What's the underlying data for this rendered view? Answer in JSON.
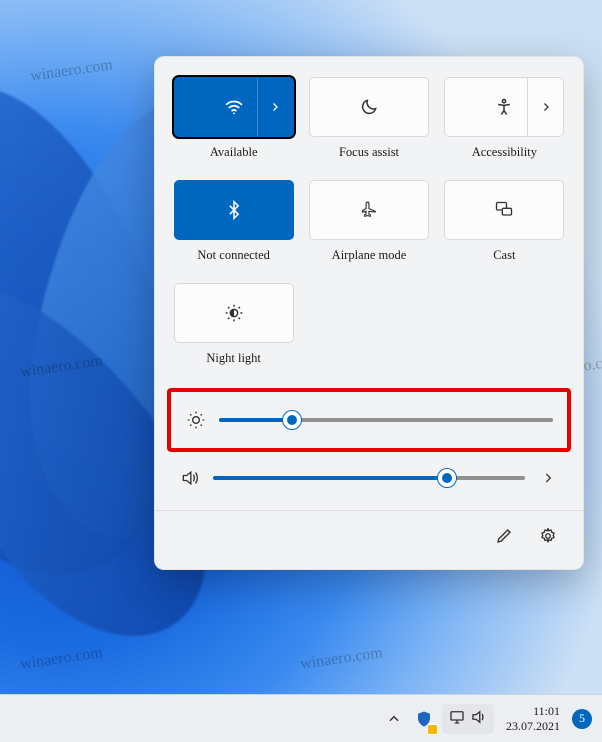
{
  "watermark": "winaero.com",
  "panel": {
    "tiles": [
      {
        "id": "wifi",
        "label": "Available",
        "active": true,
        "split": true,
        "selected": true
      },
      {
        "id": "focus",
        "label": "Focus assist",
        "active": false,
        "split": false
      },
      {
        "id": "accessibility",
        "label": "Accessibility",
        "active": false,
        "split": true
      },
      {
        "id": "bluetooth",
        "label": "Not connected",
        "active": true,
        "split": false
      },
      {
        "id": "airplane",
        "label": "Airplane mode",
        "active": false,
        "split": false
      },
      {
        "id": "cast",
        "label": "Cast",
        "active": false,
        "split": false
      },
      {
        "id": "nightlight",
        "label": "Night light",
        "active": false,
        "split": false
      }
    ],
    "sliders": {
      "brightness": {
        "value": 22,
        "highlighted": true
      },
      "volume": {
        "value": 75,
        "expand": true
      }
    }
  },
  "taskbar": {
    "time": "11:01",
    "date": "23.07.2021",
    "notification_count": "5"
  }
}
